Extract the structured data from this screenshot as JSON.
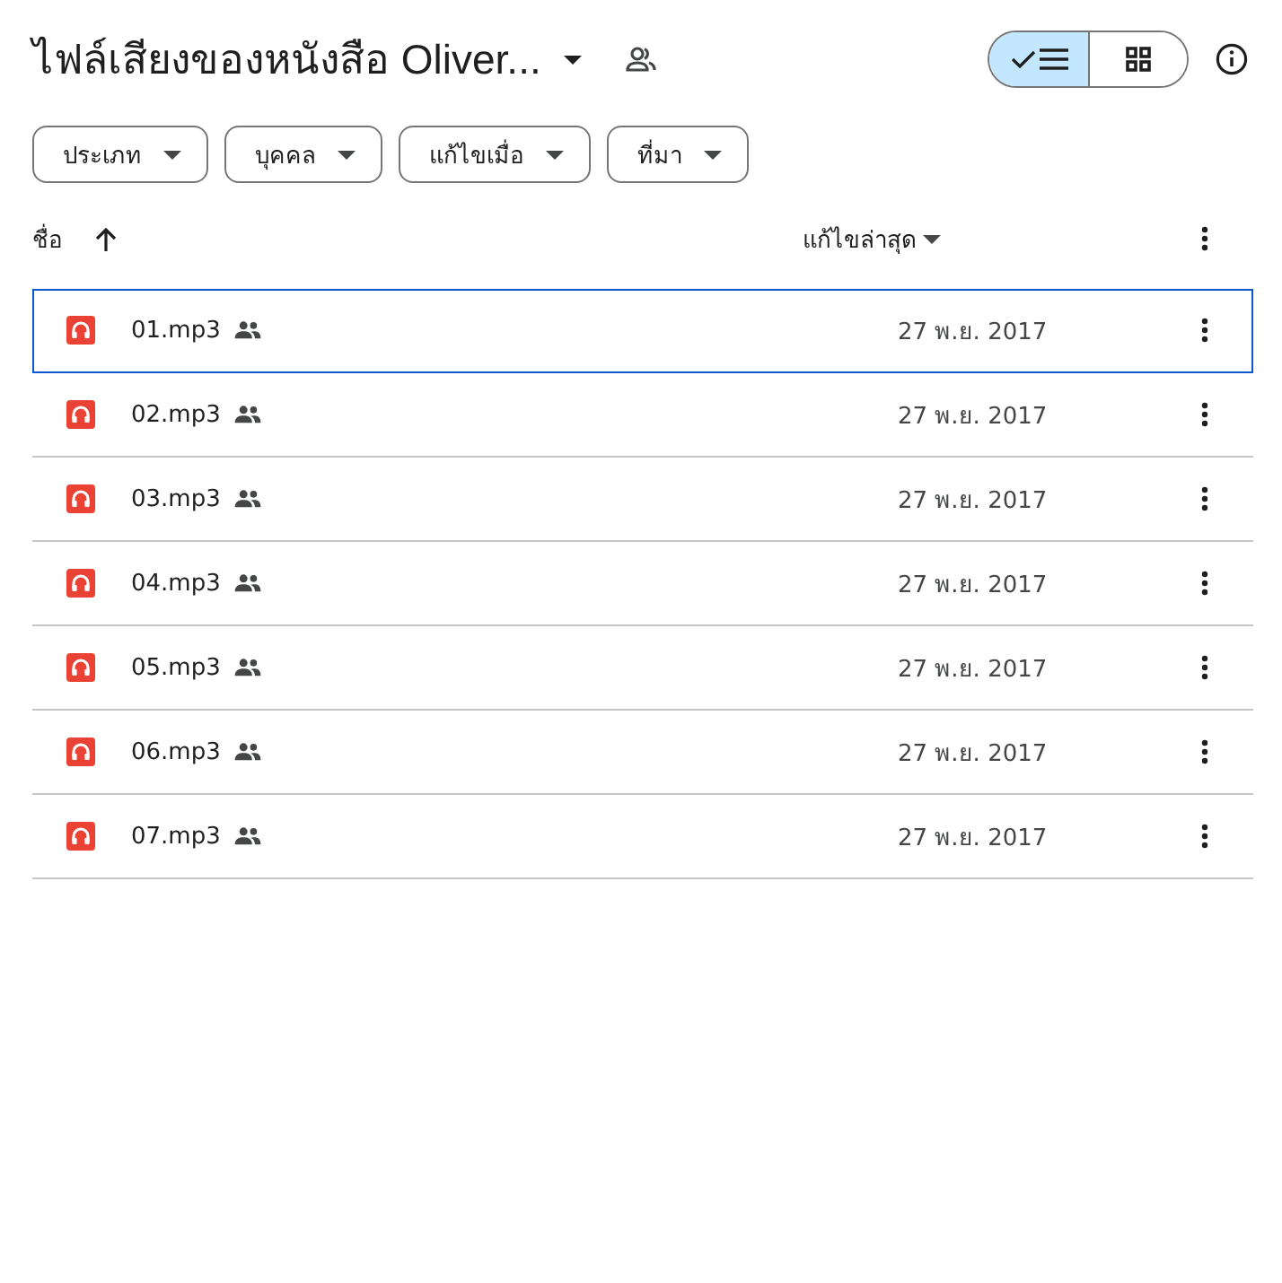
{
  "header": {
    "title": "ไฟล์เสียงของหนังสือ Oliver..."
  },
  "view_toggle": [
    {
      "kind": "list",
      "selected": true
    },
    {
      "kind": "grid",
      "selected": false
    }
  ],
  "filters": [
    "ประเภท",
    "บุคคล",
    "แก้ไขเมื่อ",
    "ที่มา"
  ],
  "table": {
    "columns": [
      {
        "label": "ชื่อ",
        "kind": "arrow"
      },
      {
        "label": "แก้ไขล่าสุด",
        "kind": "caret"
      }
    ],
    "rows": [
      {
        "name": "01.mp3",
        "modified": "27 พ.ย. 2017",
        "selected": true
      },
      {
        "name": "02.mp3",
        "modified": "27 พ.ย. 2017",
        "selected": false
      },
      {
        "name": "03.mp3",
        "modified": "27 พ.ย. 2017",
        "selected": false
      },
      {
        "name": "04.mp3",
        "modified": "27 พ.ย. 2017",
        "selected": false
      },
      {
        "name": "05.mp3",
        "modified": "27 พ.ย. 2017",
        "selected": false
      },
      {
        "name": "06.mp3",
        "modified": "27 พ.ย. 2017",
        "selected": false
      },
      {
        "name": "07.mp3",
        "modified": "27 พ.ย. 2017",
        "selected": false
      }
    ]
  }
}
